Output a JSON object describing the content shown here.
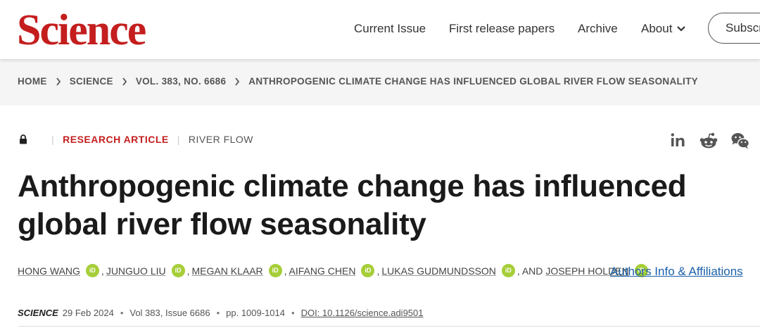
{
  "header": {
    "logo": "Science",
    "nav": [
      "Current Issue",
      "First release papers",
      "Archive",
      "About"
    ],
    "subscribe_label": "Subscribe"
  },
  "breadcrumb": [
    "HOME",
    "SCIENCE",
    "VOL. 383, NO. 6686",
    "ANTHROPOGENIC CLIMATE CHANGE HAS INFLUENCED GLOBAL RIVER FLOW SEASONALITY"
  ],
  "article": {
    "type_label": "RESEARCH ARTICLE",
    "category": "RIVER FLOW",
    "title": "Anthropogenic climate change has influenced global river flow seasonality",
    "authors": [
      "HONG WANG",
      "JUNGUO LIU",
      "MEGAN KLAAR",
      "AIFANG CHEN",
      "LUKAS GUDMUNDSSON",
      "JOSEPH HOLDEN"
    ],
    "and_text": "AND",
    "orcid_label": "iD",
    "affiliations_link": "Authors Info & Affiliations",
    "journal": "SCIENCE",
    "date": "29 Feb 2024",
    "volume": "Vol 383, Issue 6686",
    "pages": "pp. 1009-1014",
    "doi": "DOI: 10.1126/science.adi9501"
  },
  "share_icons": [
    "linkedin-icon",
    "reddit-icon",
    "wechat-icon"
  ],
  "colors": {
    "brand": "#c41e1e",
    "orcid": "#a6ce39",
    "link": "#1a5fa8",
    "crumb_bg": "#f5f5f5"
  }
}
